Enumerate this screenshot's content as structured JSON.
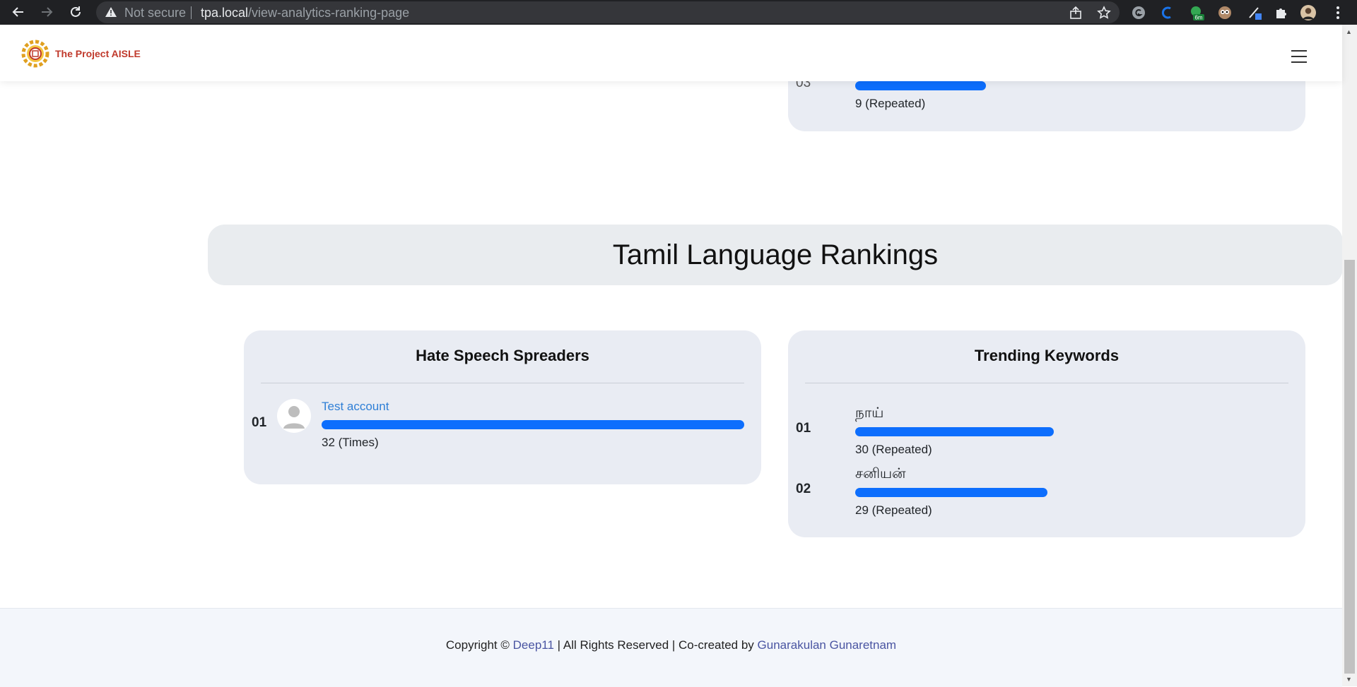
{
  "browser": {
    "security_label": "Not secure",
    "url_host": "tpa.local",
    "url_path": "/view-analytics-ranking-page",
    "extension_badge": "6m"
  },
  "header": {
    "brand": "The Project AISLE"
  },
  "top_card": {
    "rank": "03",
    "caption": "9 (Repeated)",
    "bar_fraction": 0.31
  },
  "section": {
    "title": "Tamil Language Rankings"
  },
  "spreaders": {
    "title": "Hate Speech Spreaders",
    "items": [
      {
        "rank": "01",
        "name": "Test account",
        "caption": "32 (Times)",
        "bar_fraction": 1.0
      }
    ]
  },
  "keywords": {
    "title": "Trending Keywords",
    "items": [
      {
        "rank": "01",
        "keyword": "நாய்",
        "caption": "30 (Repeated)",
        "bar_fraction": 0.47
      },
      {
        "rank": "02",
        "keyword": "சனியன்",
        "caption": "29 (Repeated)",
        "bar_fraction": 0.455
      }
    ]
  },
  "footer": {
    "prefix": "Copyright ©",
    "company": "Deep11",
    "middle": "| All Rights Reserved | Co-created by",
    "author": "Gunarakulan Gunaretnam"
  },
  "colors": {
    "bar": "#0d6efd",
    "card": "#e9ecf3",
    "brand": "#c0392b",
    "link": "#2f7fd6"
  }
}
